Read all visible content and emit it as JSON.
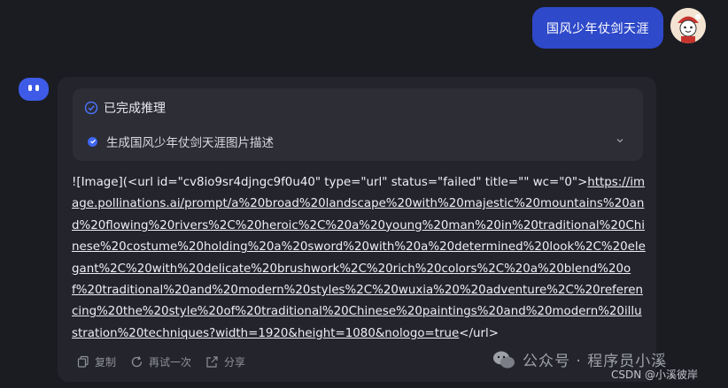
{
  "user_message": {
    "text": "国风少年仗剑天涯"
  },
  "reasoning": {
    "title": "已完成推理",
    "step": "生成国风少年仗剑天涯图片描述"
  },
  "response": {
    "prefix": "![Image](<url id=\"cv8io9sr4djngc9f0u40\" type=\"url\" status=\"failed\" title=\"\" wc=\"0\">",
    "link": "https://image.pollinations.ai/prompt/a%20broad%20landscape%20with%20majestic%20mountains%20and%20flowing%20rivers%2C%20heroic%2C%20a%20young%20man%20in%20traditional%20Chinese%20costume%20holding%20a%20sword%20with%20a%20determined%20look%2C%20elegant%2C%20with%20delicate%20brushwork%2C%20rich%20colors%2C%20a%20blend%20of%20traditional%20and%20modern%20styles%2C%20wuxia%20%20adventure%2C%20referencing%20the%20style%20of%20traditional%20Chinese%20paintings%20and%20modern%20illustration%20techniques?width=1920&height=1080&nologo=true",
    "suffix": "</url>"
  },
  "actions": {
    "copy": "复制",
    "retry": "再试一次",
    "share": "分享"
  },
  "watermark": {
    "text": "公众号 · 程序员小溪"
  },
  "csdn": {
    "text": "CSDN @小溪彼岸"
  },
  "colors": {
    "accent": "#3e5be7",
    "user_bubble": "#2e49c9",
    "background": "#1b1c22"
  }
}
